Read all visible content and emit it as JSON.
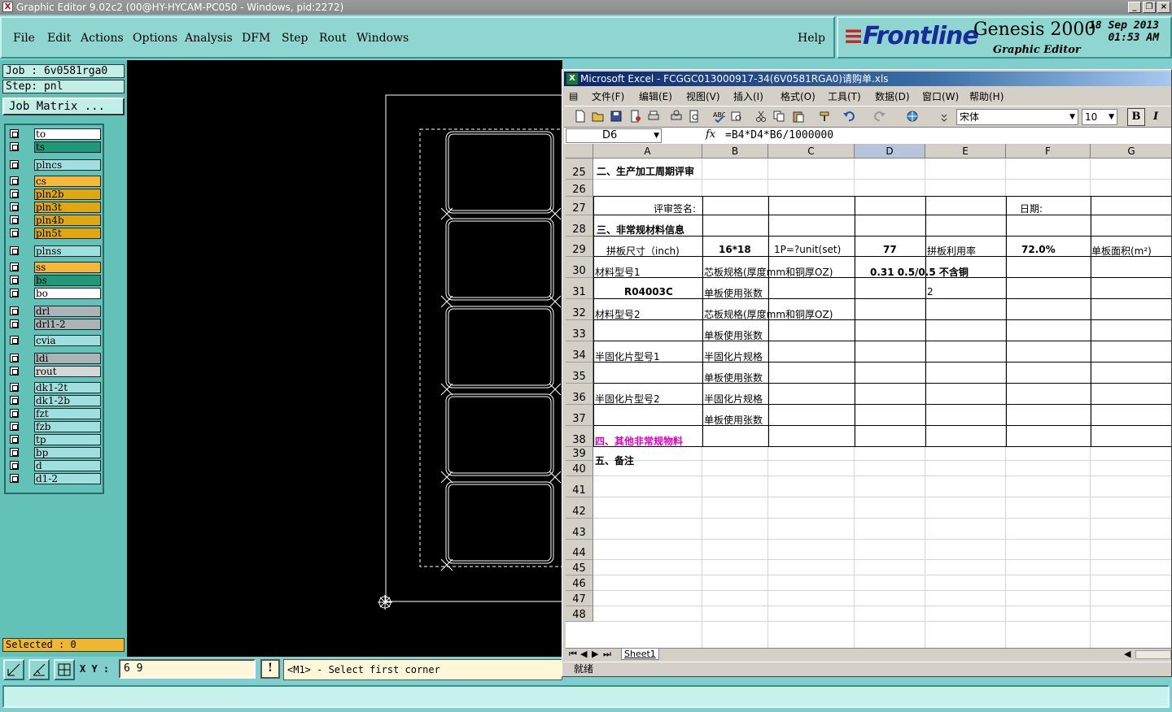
{
  "window_title": "Graphic Editor 9.02c2 (00@HY-HYCAM-PC050 - Windows, pid:2272)",
  "menu": [
    "File",
    "Edit",
    "Actions",
    "Options",
    "Analysis",
    "DFM",
    "Step",
    "Rout",
    "Windows"
  ],
  "help": "Help",
  "brand": {
    "logo": "Frontline",
    "product": "Genesis 2000",
    "subtitle": "Graphic Editor",
    "date": "18 Sep 2013",
    "time": "01:53 AM"
  },
  "job_label": "Job : 6v0581rga0",
  "step_label": "Step: pnl",
  "job_matrix": "Job Matrix ...",
  "layers": [
    {
      "name": "to",
      "color": "#ffffff"
    },
    {
      "name": "ts",
      "color": "#1f9a78"
    },
    {
      "name": "plncs",
      "color": "#9ee0e0"
    },
    {
      "name": "cs",
      "color": "#f5b93a"
    },
    {
      "name": "pln2b",
      "color": "#e0a810"
    },
    {
      "name": "pln3t",
      "color": "#e0a810"
    },
    {
      "name": "pln4b",
      "color": "#e0a810"
    },
    {
      "name": "pln5t",
      "color": "#e0a810"
    },
    {
      "name": "plnss",
      "color": "#9ee0e0"
    },
    {
      "name": "ss",
      "color": "#f5b93a"
    },
    {
      "name": "bs",
      "color": "#1f9a78"
    },
    {
      "name": "bo",
      "color": "#ffffff"
    },
    {
      "name": "drl",
      "color": "#a8b4b8"
    },
    {
      "name": "drl1-2",
      "color": "#a8b4b8"
    },
    {
      "name": "cvia",
      "color": "#9ee0e0"
    },
    {
      "name": "ldi",
      "color": "#a8b4b8"
    },
    {
      "name": "rout",
      "color": "#d4d8d8"
    },
    {
      "name": "dk1-2t",
      "color": "#9ee0e0"
    },
    {
      "name": "dk1-2b",
      "color": "#9ee0e0"
    },
    {
      "name": "fzt",
      "color": "#9ee0e0"
    },
    {
      "name": "fzb",
      "color": "#9ee0e0"
    },
    {
      "name": "tp",
      "color": "#9ee0e0"
    },
    {
      "name": "bp",
      "color": "#9ee0e0"
    },
    {
      "name": "d",
      "color": "#9ee0e0"
    },
    {
      "name": "d1-2",
      "color": "#9ee0e0"
    }
  ],
  "selected": "Selected : 0",
  "xy_label": "X Y :",
  "xy_value": "6 9",
  "info_btn": "!",
  "prompt": "<M1> - Select first corner",
  "excel": {
    "title": "Microsoft Excel - FCGGC013000917-34(6V0581RGA0)请购单.xls",
    "menu": [
      "文件(F)",
      "编辑(E)",
      "视图(V)",
      "插入(I)",
      "格式(O)",
      "工具(T)",
      "数据(D)",
      "窗口(W)",
      "帮助(H)"
    ],
    "font_name": "宋体",
    "font_size": "10",
    "bold_btn": "B",
    "italic_btn": "I",
    "name_box": "D6",
    "fx": "fx",
    "formula": "=B4*D4*B6/1000000",
    "columns": [
      "A",
      "B",
      "C",
      "D",
      "E",
      "F",
      "G"
    ],
    "rows": [
      "25",
      "26",
      "27",
      "28",
      "29",
      "30",
      "31",
      "32",
      "33",
      "34",
      "35",
      "36",
      "37",
      "38",
      "39",
      "40",
      "41",
      "42",
      "43",
      "44",
      "45",
      "46",
      "47",
      "48"
    ],
    "cells": {
      "r25": "二、生产加工周期评审",
      "r27a": "评审签名:",
      "r27e": "日期:",
      "r28": "三、非常规材料信息",
      "r29a": "拼板尺寸（inch)",
      "r29b": "16*18",
      "r29c": "1P=?unit(set)",
      "r29d": "77",
      "r29e": "拼板利用率",
      "r29f": "72.0%",
      "r29g": "单板面积(m²)",
      "r30a": "材料型号1",
      "r30b": "芯板规格(厚度mm和铜厚OZ)",
      "r30d": "0.31 0.5/0.5 不含铜",
      "r31a": "R04003C",
      "r31b": "单板使用张数",
      "r31d": "2",
      "r32a": "材料型号2",
      "r32b": "芯板规格(厚度mm和铜厚OZ)",
      "r33b": "单板使用张数",
      "r34a": "半固化片型号1",
      "r34b": "半固化片规格",
      "r35b": "单板使用张数",
      "r36a": "半固化片型号2",
      "r36b": "半固化片规格",
      "r37b": "单板使用张数",
      "r38": "四、其他非常规物料",
      "r39": "五、备注"
    },
    "sheet_tab": "Sheet1",
    "status": "就绪"
  }
}
